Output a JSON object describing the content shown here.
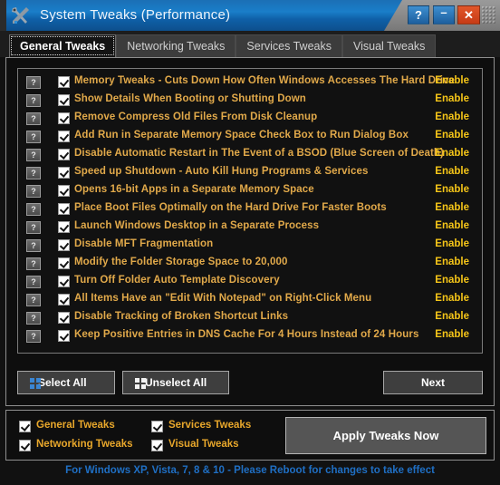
{
  "window": {
    "title": "System Tweaks (Performance)",
    "icon": "wrench-screwdriver-icon",
    "controls": {
      "help_label": "?",
      "minimize_label": "–",
      "close_label": "✕"
    },
    "accent_titlebar": "#1a7ec9",
    "accent_close": "#d5411c"
  },
  "tabs": [
    {
      "label": "General Tweaks",
      "active": true
    },
    {
      "label": "Networking Tweaks",
      "active": false
    },
    {
      "label": "Services Tweaks",
      "active": false
    },
    {
      "label": "Visual Tweaks",
      "active": false
    }
  ],
  "list": {
    "help_button_label": "?",
    "action_label": "Enable",
    "label_color": "#e1a94a",
    "action_color": "#f5c518",
    "items": [
      {
        "label": "Memory Tweaks - Cuts Down How Often Windows Accesses The Hard Drive",
        "checked": true,
        "action": "Enable"
      },
      {
        "label": "Show Details When Booting or Shutting Down",
        "checked": true,
        "action": "Enable"
      },
      {
        "label": "Remove Compress Old Files From Disk Cleanup",
        "checked": true,
        "action": "Enable"
      },
      {
        "label": "Add Run in Separate Memory Space Check Box to Run Dialog Box",
        "checked": true,
        "action": "Enable"
      },
      {
        "label": "Disable Automatic Restart in The Event of a BSOD (Blue Screen of Death)",
        "checked": true,
        "action": "Enable"
      },
      {
        "label": "Speed up Shutdown - Auto Kill Hung Programs & Services",
        "checked": true,
        "action": "Enable"
      },
      {
        "label": "Opens 16-bit Apps in a Separate Memory Space",
        "checked": true,
        "action": "Enable"
      },
      {
        "label": "Place Boot Files Optimally on the Hard Drive For Faster Boots",
        "checked": true,
        "action": "Enable"
      },
      {
        "label": "Launch Windows Desktop in a Separate Process",
        "checked": true,
        "action": "Enable"
      },
      {
        "label": "Disable MFT Fragmentation",
        "checked": true,
        "action": "Enable"
      },
      {
        "label": "Modify the Folder Storage Space to 20,000",
        "checked": true,
        "action": "Enable"
      },
      {
        "label": "Turn Off Folder Auto Template Discovery",
        "checked": true,
        "action": "Enable"
      },
      {
        "label": "All Items Have an \"Edit With Notepad\" on Right-Click Menu",
        "checked": true,
        "action": "Enable"
      },
      {
        "label": "Disable Tracking of Broken Shortcut Links",
        "checked": true,
        "action": "Enable"
      },
      {
        "label": "Keep Positive Entries in DNS Cache For 4 Hours Instead of 24 Hours",
        "checked": true,
        "action": "Enable"
      }
    ]
  },
  "panel_buttons": {
    "select_all": "Select All",
    "unselect_all": "Unselect All",
    "next": "Next",
    "select_all_icon": "grid-2x2-icon",
    "unselect_all_icon": "grid-2x2-icon"
  },
  "footer": {
    "categories": [
      {
        "label": "General Tweaks",
        "checked": true
      },
      {
        "label": "Networking Tweaks",
        "checked": true
      },
      {
        "label": "Services Tweaks",
        "checked": true
      },
      {
        "label": "Visual Tweaks",
        "checked": true
      }
    ],
    "apply_label": "Apply Tweaks Now"
  },
  "status": {
    "text": "For Windows XP, Vista, 7, 8 & 10 - Please Reboot for changes to take effect",
    "color": "#1f6fc4"
  }
}
